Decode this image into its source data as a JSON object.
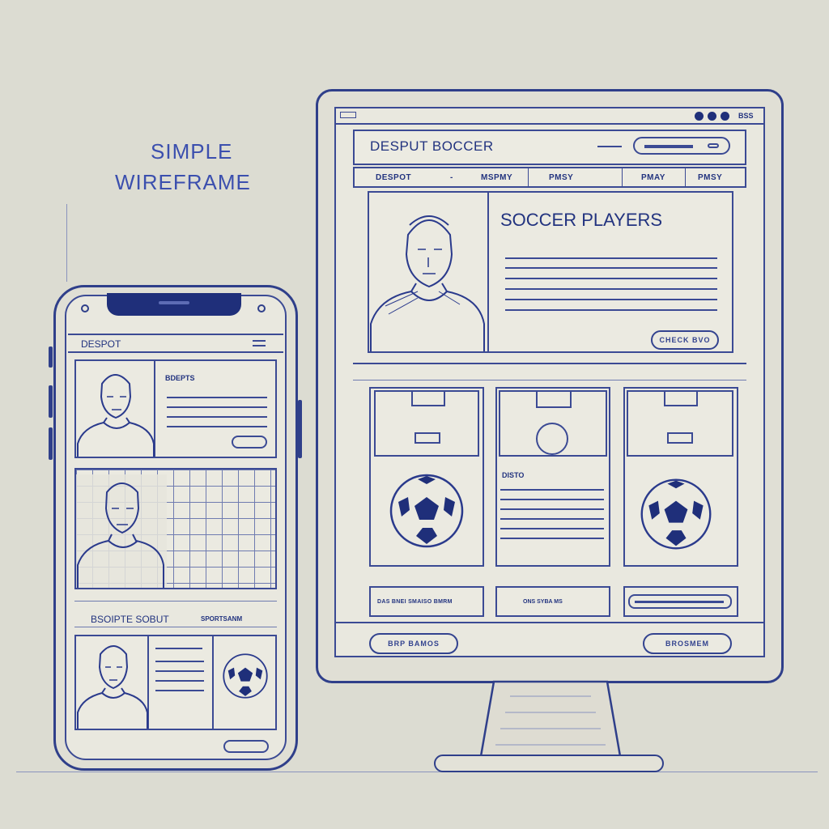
{
  "title": {
    "line1": "SIMPLE",
    "line2": "WIREFRAME"
  },
  "colors": {
    "ink": "#2a3a8c",
    "paper": "#e9e8df",
    "background": "#dcdcd2"
  },
  "desktop": {
    "brand": "DESPUT BOCCER",
    "nav": [
      "DESPOT",
      "-",
      "MSPMY",
      "PMSY",
      "PMAY",
      "PMSY"
    ],
    "hero_title": "SOCCER PLAYERS",
    "hero_button": "CHECK BVO",
    "feature_label": "DISTO",
    "footer_left_link": "DAS BNEI SMAISO BMRM",
    "footer_center_link": "ONS SYBA MS",
    "bottom_left_button": "BRP BAMOS",
    "bottom_right_button": "BROSMEM",
    "window_dots_label": "BSS"
  },
  "mobile": {
    "brand": "DESPOT",
    "card1_label": "BDEPTS",
    "section_label": "BSOIPTE SOBUT",
    "section_label_right": "SPORTSANM"
  }
}
